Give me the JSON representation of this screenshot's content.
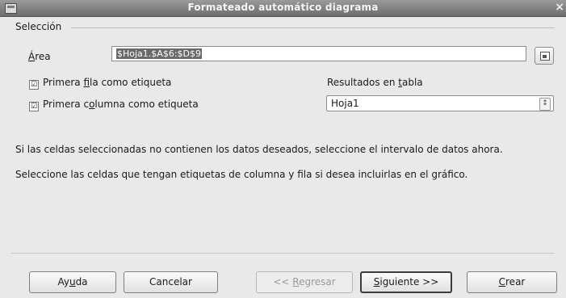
{
  "window": {
    "title": "Formateado automático diagrama",
    "close_glyph": "×"
  },
  "selection": {
    "section_label": "Selección",
    "area_label_mnemonic": "Á",
    "area_label_rest": "rea",
    "area_value": "$Hoja1.$A$6:$D$9",
    "first_row_pre": "Primera ",
    "first_row_mn": "f",
    "first_row_post": "ila como etiqueta",
    "first_row_checked": true,
    "first_col_pre": "Primera c",
    "first_col_mn": "o",
    "first_col_post": "lumna como etiqueta",
    "first_col_checked": true,
    "check_glyph": "☑",
    "results_pre": "Resultados en ",
    "results_mn": "t",
    "results_post": "abla",
    "results_value": "Hoja1",
    "spin_glyph": "↕"
  },
  "info": {
    "line1": "Si las celdas seleccionadas no contienen los datos deseados, seleccione el intervalo de datos ahora.",
    "line2": "Seleccione las celdas que tengan etiquetas de columna y fila si desea incluirlas en el gráfico."
  },
  "buttons": {
    "help_pre": "Ay",
    "help_mn": "u",
    "help_post": "da",
    "cancel": "Cancelar",
    "back_pre": "<< ",
    "back_mn": "R",
    "back_post": "egresar",
    "next_mn": "S",
    "next_post": "iguiente >>",
    "create_mn": "C",
    "create_post": "rear"
  },
  "icons": [
    "window-icon",
    "close-icon",
    "shrink-icon",
    "checkbox-icon",
    "spin-icon"
  ]
}
